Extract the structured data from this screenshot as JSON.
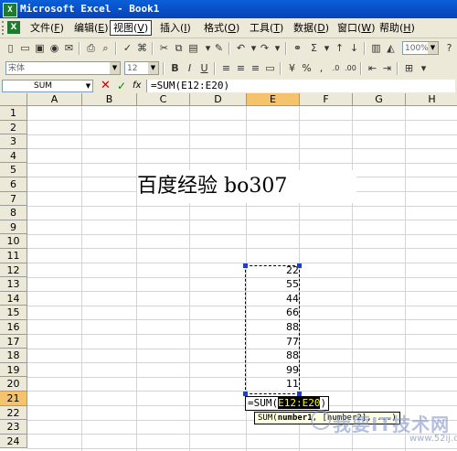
{
  "window": {
    "title": "Microsoft Excel - Book1",
    "app_icon": "X"
  },
  "menu": [
    {
      "label": "文件",
      "key": "F"
    },
    {
      "label": "编辑",
      "key": "E"
    },
    {
      "label": "视图",
      "key": "V"
    },
    {
      "label": "插入",
      "key": "I"
    },
    {
      "label": "格式",
      "key": "O"
    },
    {
      "label": "工具",
      "key": "T"
    },
    {
      "label": "数据",
      "key": "D"
    },
    {
      "label": "窗口",
      "key": "W"
    },
    {
      "label": "帮助",
      "key": "H"
    }
  ],
  "menu_active": "视图",
  "format_toolbar": {
    "font": "宋体",
    "size": "12"
  },
  "formula_bar": {
    "name_box": "SUM",
    "formula": "=SUM(E12:E20)"
  },
  "columns": [
    "A",
    "B",
    "C",
    "D",
    "E",
    "F",
    "G",
    "H"
  ],
  "selected_column": "E",
  "rows": [
    "1",
    "2",
    "3",
    "4",
    "5",
    "6",
    "7",
    "8",
    "9",
    "10",
    "11",
    "12",
    "13",
    "14",
    "15",
    "16",
    "17",
    "18",
    "19",
    "20",
    "21",
    "22",
    "23",
    "24"
  ],
  "selected_row": "21",
  "sheet": {
    "heading_text": "百度经验 bo307",
    "e_values": [
      "22",
      "55",
      "44",
      "66",
      "88",
      "77",
      "88",
      "99",
      "11"
    ],
    "editing_prefix": "=SUM(",
    "editing_range": "E12:E20",
    "editing_suffix": ")"
  },
  "tooltip": {
    "func": "SUM(",
    "arg1": "number1",
    "rest": ", [number2], ...)"
  },
  "watermark": {
    "text": "我要IT技术网",
    "url": "www.52ij.com"
  },
  "colors": {
    "title_bar": "#0842b8",
    "selection_header": "#f5c36c",
    "range_highlight": "#000000"
  }
}
